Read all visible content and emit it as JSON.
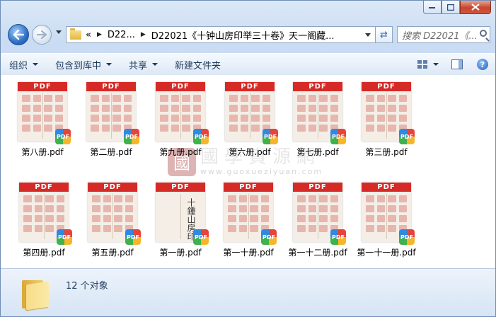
{
  "nav": {
    "back_icon": "back-arrow-icon",
    "forward_icon": "forward-arrow-icon",
    "breadcrumb": [
      "«",
      "D22...",
      "D22021《十钟山房印举三十卷》天一阁藏..."
    ],
    "search_placeholder": "搜索 D22021《...",
    "refresh_icon": "refresh-icon"
  },
  "toolbar": {
    "organize": "组织",
    "include_library": "包含到库中",
    "share": "共享",
    "new_folder": "新建文件夹"
  },
  "watermark": {
    "seal": "國",
    "text": "國學資源網",
    "url": "www.guoxueziyuan.com"
  },
  "files": [
    {
      "name": "第八册.pdf",
      "banner": "PDF",
      "badge": "PDF"
    },
    {
      "name": "第二册.pdf",
      "banner": "PDF",
      "badge": "PDF"
    },
    {
      "name": "第九册.pdf",
      "banner": "PDF",
      "badge": "PDF"
    },
    {
      "name": "第六册.pdf",
      "banner": "PDF",
      "badge": "PDF"
    },
    {
      "name": "第七册.pdf",
      "banner": "PDF",
      "badge": "PDF"
    },
    {
      "name": "第三册.pdf",
      "banner": "PDF",
      "badge": "PDF"
    },
    {
      "name": "第四册.pdf",
      "banner": "PDF",
      "badge": "PDF"
    },
    {
      "name": "第五册.pdf",
      "banner": "PDF",
      "badge": "PDF"
    },
    {
      "name": "第一册.pdf",
      "banner": "PDF",
      "badge": "PDF",
      "title_page": "十鍾山房印"
    },
    {
      "name": "第一十册.pdf",
      "banner": "PDF",
      "badge": "PDF"
    },
    {
      "name": "第一十二册.pdf",
      "banner": "PDF",
      "badge": "PDF"
    },
    {
      "name": "第一十一册.pdf",
      "banner": "PDF",
      "badge": "PDF"
    }
  ],
  "status": {
    "count": "12 个对象"
  },
  "colors": {
    "pdf_banner": "#d62a27",
    "seal_red": "#e4a8a0",
    "accent": "#1e395b"
  }
}
